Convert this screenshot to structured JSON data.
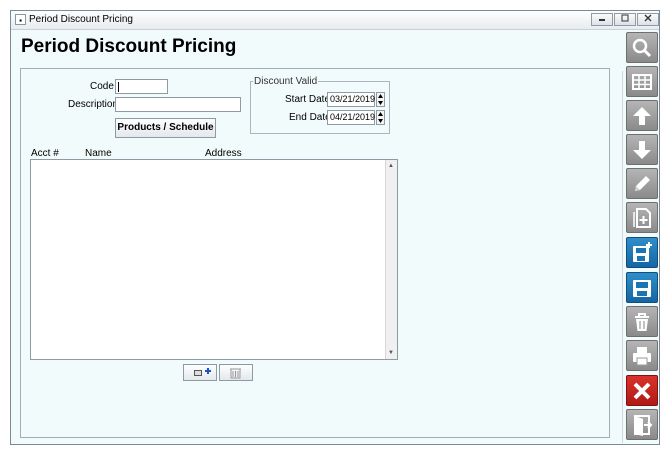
{
  "window": {
    "title": "Period Discount Pricing",
    "sysmenu_glyph": "▪"
  },
  "page": {
    "title": "Period Discount Pricing"
  },
  "form": {
    "code_label": "Code",
    "code_value": "",
    "description_label": "Description",
    "description_value": "",
    "products_button": "Products / Schedule"
  },
  "discount_valid": {
    "legend": "Discount Valid",
    "start_label": "Start Date",
    "start_value": "03/21/2019",
    "end_label": "End Date",
    "end_value": "04/21/2019"
  },
  "list": {
    "columns": [
      "Acct #",
      "Name",
      "Address"
    ],
    "rows": []
  },
  "toolbar": {
    "items": [
      {
        "name": "search",
        "icon": "search-icon"
      },
      {
        "name": "grid",
        "icon": "grid-icon"
      },
      {
        "name": "up",
        "icon": "arrow-up-icon"
      },
      {
        "name": "down",
        "icon": "arrow-down-icon"
      },
      {
        "name": "edit",
        "icon": "pencil-icon"
      },
      {
        "name": "new",
        "icon": "new-document-icon"
      },
      {
        "name": "save-new",
        "icon": "save-new-icon"
      },
      {
        "name": "save",
        "icon": "save-icon"
      },
      {
        "name": "delete",
        "icon": "trash-icon"
      },
      {
        "name": "print",
        "icon": "printer-icon"
      },
      {
        "name": "cancel",
        "icon": "close-icon"
      },
      {
        "name": "exit",
        "icon": "exit-icon"
      }
    ]
  },
  "colors": {
    "accent_blue": "#1a75b5",
    "cancel_red": "#c82a22",
    "tool_gray": "#9a9a9a",
    "background": "#f2fbfb"
  }
}
